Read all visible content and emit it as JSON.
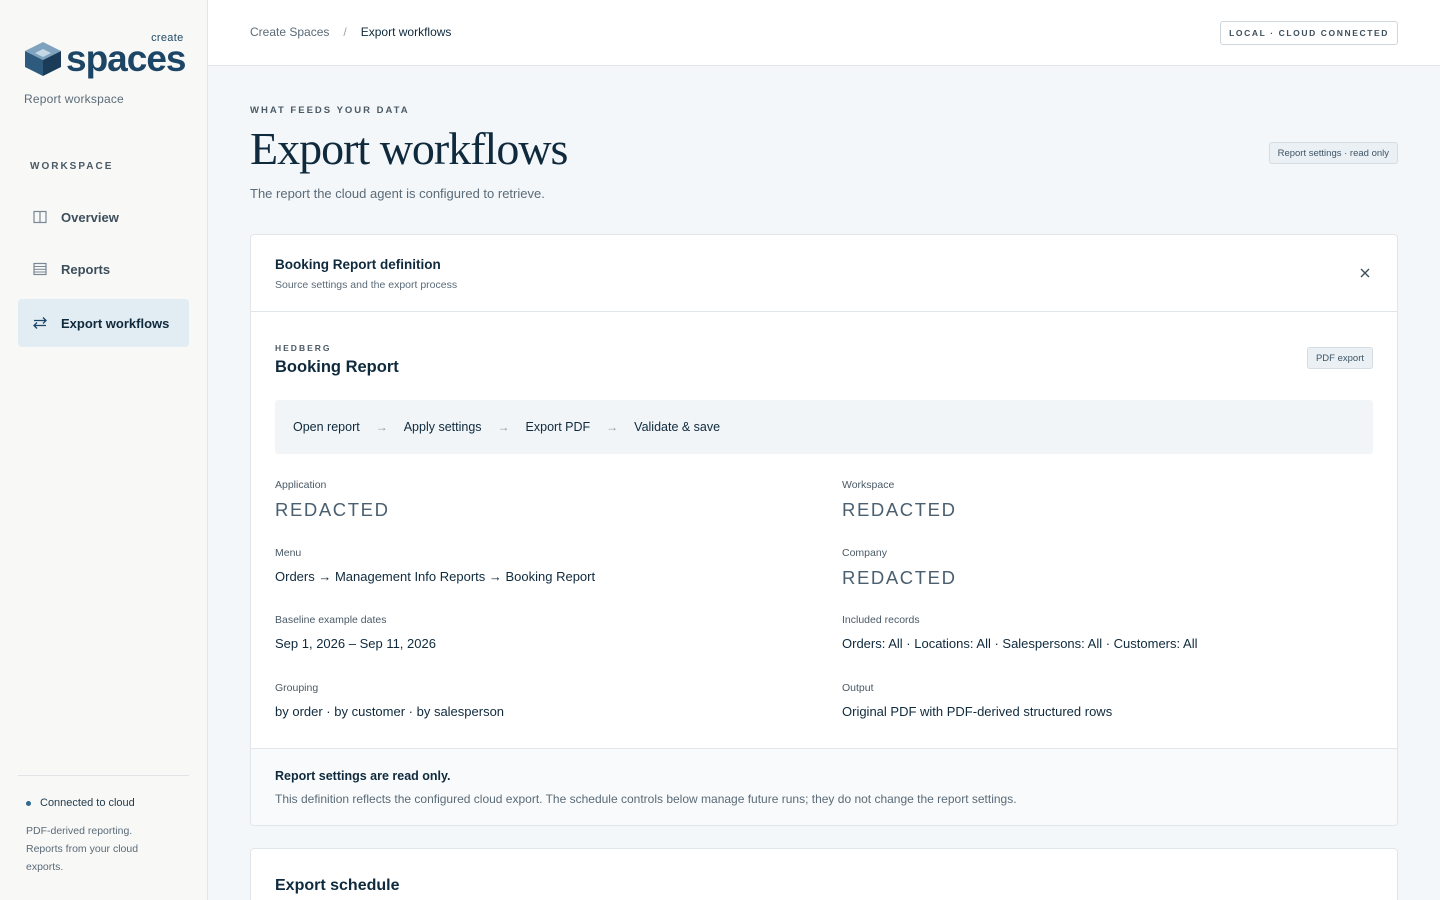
{
  "sidebar": {
    "logo_create": "create",
    "logo_word": "spaces",
    "subtitle": "Report workspace",
    "section_label": "WORKSPACE",
    "items": [
      {
        "label": "Overview",
        "icon": "columns-icon"
      },
      {
        "label": "Reports",
        "icon": "table-icon"
      },
      {
        "label": "Export workflows",
        "icon": "arrows-exchange-icon",
        "active": true
      }
    ],
    "connection_status": "Connected to cloud",
    "note": "PDF-derived reporting. Reports from your cloud exports."
  },
  "topbar": {
    "breadcrumb": [
      "Create Spaces",
      "Export workflows"
    ],
    "breadcrumb_separator": "/",
    "status_pill": "LOCAL · CLOUD CONNECTED"
  },
  "header": {
    "eyebrow": "WHAT FEEDS YOUR DATA",
    "title": "Export workflows",
    "description": "The report the cloud agent is configured to retrieve.",
    "readonly_pill": "Report settings · read only"
  },
  "definition_card": {
    "title": "Booking Report definition",
    "subtitle": "Source settings and the export process",
    "vendor": "HEDBERG",
    "report_name": "Booking Report",
    "format_pill": "PDF export",
    "steps": [
      "Open report",
      "Apply settings",
      "Export PDF",
      "Validate & save"
    ],
    "fields": {
      "application": {
        "label": "Application",
        "value": "REDACTED"
      },
      "workspace": {
        "label": "Workspace",
        "value": "REDACTED"
      },
      "menu": {
        "label": "Menu",
        "value": "Orders → Management Info Reports → Booking Report"
      },
      "company": {
        "label": "Company",
        "value": "REDACTED"
      },
      "baseline_dates": {
        "label": "Baseline example dates",
        "value": "Sep 1, 2026 – Sep 11, 2026"
      },
      "included_records": {
        "label": "Included records",
        "value": "Orders: All · Locations: All · Salespersons: All · Customers: All"
      },
      "grouping": {
        "label": "Grouping",
        "value": "by order · by customer · by salesperson"
      },
      "output": {
        "label": "Output",
        "value": "Original PDF with PDF-derived structured rows"
      }
    },
    "footer_title": "Report settings are read only.",
    "footer_text": "This definition reflects the configured cloud export. The schedule controls below manage future runs; they do not change the report settings."
  },
  "schedule_card": {
    "title": "Export schedule"
  },
  "colors": {
    "brand": "#1d4566",
    "active_nav_bg": "#e2ecf3",
    "text_primary": "#0f2a3d"
  }
}
